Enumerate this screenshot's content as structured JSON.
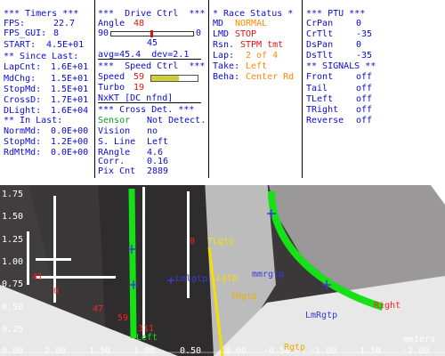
{
  "timers": {
    "header": "*** Timers ***",
    "fps_label": "FPS:",
    "fps_value": "22.7",
    "fps_gui_label": "FPS_GUI:",
    "fps_gui_value": "8",
    "start_label": "START:",
    "start_value": "4.5E+01",
    "since_header": "** Since Last:",
    "since_rows": [
      {
        "label": "LapCnt:",
        "value": "1.6E+01"
      },
      {
        "label": "MdChg:",
        "value": "1.5E+01"
      },
      {
        "label": "StopMd:",
        "value": "1.5E+01"
      },
      {
        "label": "CrossD:",
        "value": "1.7E+01"
      },
      {
        "label": "DLight:",
        "value": "1.6E+04"
      }
    ],
    "in_header": "** In Last:",
    "in_rows": [
      {
        "label": "NormMd:",
        "value": "0.0E+00"
      },
      {
        "label": "StopMd:",
        "value": "1.2E+00"
      },
      {
        "label": "RdMtMd:",
        "value": "0.0E+00"
      }
    ]
  },
  "drive": {
    "header": "***  Drive Ctrl  ***",
    "angle_label": "Angle",
    "angle_value": "48",
    "range_min": "90",
    "range_max": "0",
    "slider_value": "45",
    "avg_text": "avg=45.4  dev=2.1",
    "speed_header": "***  Speed Ctrl  ***",
    "speed_label": "Speed",
    "speed_value": "59",
    "speed_fraction": 0.59,
    "turbo_label": "Turbo",
    "turbo_value": "19",
    "nxt_text": "NxKT [DC nfnd]",
    "cross_header": "*** Cross Det. ***",
    "sensor_label": "Sensor",
    "sensor_value": "Not Detect.",
    "cross_rows": [
      {
        "label": "Vision",
        "value": "no"
      },
      {
        "label": "S. Line",
        "value": "Left"
      },
      {
        "label": "RAngle",
        "value": "4.6"
      },
      {
        "label": "Corr.",
        "value": "0.16"
      },
      {
        "label": "Pix Cnt",
        "value": "2889"
      }
    ]
  },
  "race": {
    "header": "* Race Status *",
    "md_label": "MD",
    "md_value": "NORMAL",
    "lmd_label": "LMD",
    "lmd_value": "STOP",
    "rsn_label": "Rsn.",
    "rsn_value": "STPM tmt",
    "lap_label": "Lap:",
    "lap_value": "2 of 4",
    "take_label": "Take:",
    "take_value": "Left",
    "beha_label": "Beha:",
    "beha_value": "Center Rd"
  },
  "ptu": {
    "header": "*** PTU ***",
    "rows": [
      {
        "label": "CrPan",
        "value": "0"
      },
      {
        "label": "CrTlt",
        "value": "-35"
      },
      {
        "label": "DsPan",
        "value": "0"
      },
      {
        "label": "DsTlt",
        "value": "-35"
      }
    ],
    "signals_header": "** SIGNALS **",
    "signals": [
      {
        "label": "Front",
        "value": "off"
      },
      {
        "label": "Tail",
        "value": "off"
      },
      {
        "label": "TLeft",
        "value": "off"
      },
      {
        "label": "TRight",
        "value": "off"
      },
      {
        "label": "Reverse",
        "value": "off"
      }
    ]
  },
  "view": {
    "y_ticks": [
      "1.75",
      "1.50",
      "1.25",
      "1.00",
      "0.75",
      "0.50",
      "0.25",
      "0.00"
    ],
    "x_ticks": [
      "2.00",
      "1.50",
      "1.00",
      "0.50",
      "0.00",
      "-0.50",
      "-1.00",
      "-1.50",
      "-2.00"
    ],
    "units": "meters",
    "labels": {
      "ltgtp": "TLgtp",
      "lmlgtp": "Lmlgtp",
      "lgtp": "Lgtp",
      "trgtp": "TRgtp",
      "mmrgtp": "mmrgtp",
      "lm_rgtp": "LmRgtp",
      "rgtp": "Rgtp",
      "right": "Right",
      "left": "Left",
      "n311": "311",
      "n0": "0",
      "n41": "41",
      "n47": "47",
      "n59": "59",
      "n0b": "0"
    },
    "colors": {
      "lane": "#16e016",
      "marker": "#3a3ad8",
      "path": "#f4e000",
      "ref": "#ff2020",
      "gtp": "#e8b000"
    }
  }
}
